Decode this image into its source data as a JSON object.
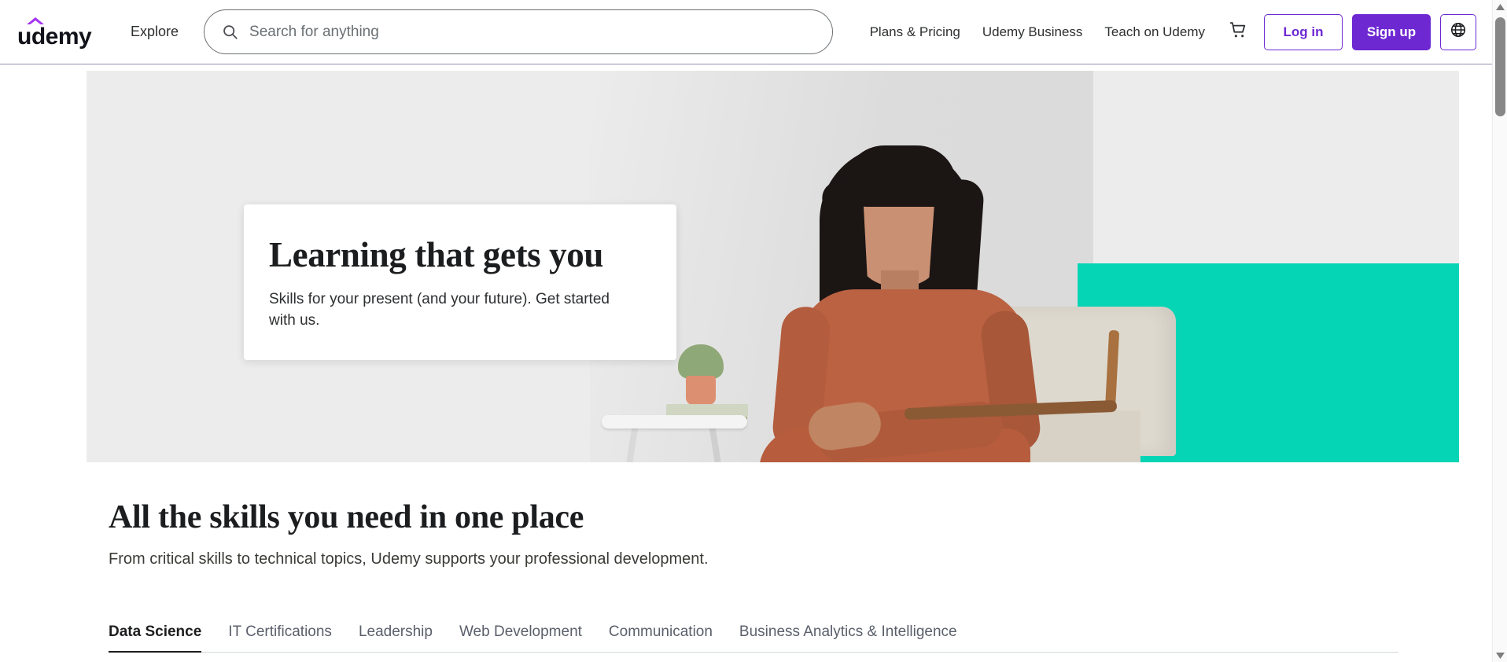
{
  "header": {
    "logo_text": "udemy",
    "logo_accent_color": "#a435f0",
    "explore_label": "Explore",
    "search": {
      "placeholder": "Search for anything",
      "value": "",
      "icon": "search-icon"
    },
    "nav_links": [
      {
        "label": "Plans & Pricing"
      },
      {
        "label": "Udemy Business"
      },
      {
        "label": "Teach on Udemy"
      }
    ],
    "cart_icon": "shopping-cart-icon",
    "login_label": "Log in",
    "signup_label": "Sign up",
    "language_icon": "globe-icon",
    "accent_color": "#6d28d2"
  },
  "hero": {
    "card": {
      "title": "Learning that gets you",
      "subtitle": "Skills for your present (and your future). Get started with us."
    },
    "background_color": "#ececec",
    "accent_panel_color": "#05d5b5",
    "photo_alt": "Smiling woman in rust colored dress seated in a chair beside a white side table with a potted plant and books"
  },
  "skills_section": {
    "title": "All the skills you need in one place",
    "subtitle": "From critical skills to technical topics, Udemy supports your professional development.",
    "tabs": [
      {
        "label": "Data Science",
        "active": true
      },
      {
        "label": "IT Certifications",
        "active": false
      },
      {
        "label": "Leadership",
        "active": false
      },
      {
        "label": "Web Development",
        "active": false
      },
      {
        "label": "Communication",
        "active": false
      },
      {
        "label": "Business Analytics & Intelligence",
        "active": false
      }
    ]
  },
  "scrollbar": {
    "up_arrow": "▲",
    "down_arrow": "▼"
  }
}
